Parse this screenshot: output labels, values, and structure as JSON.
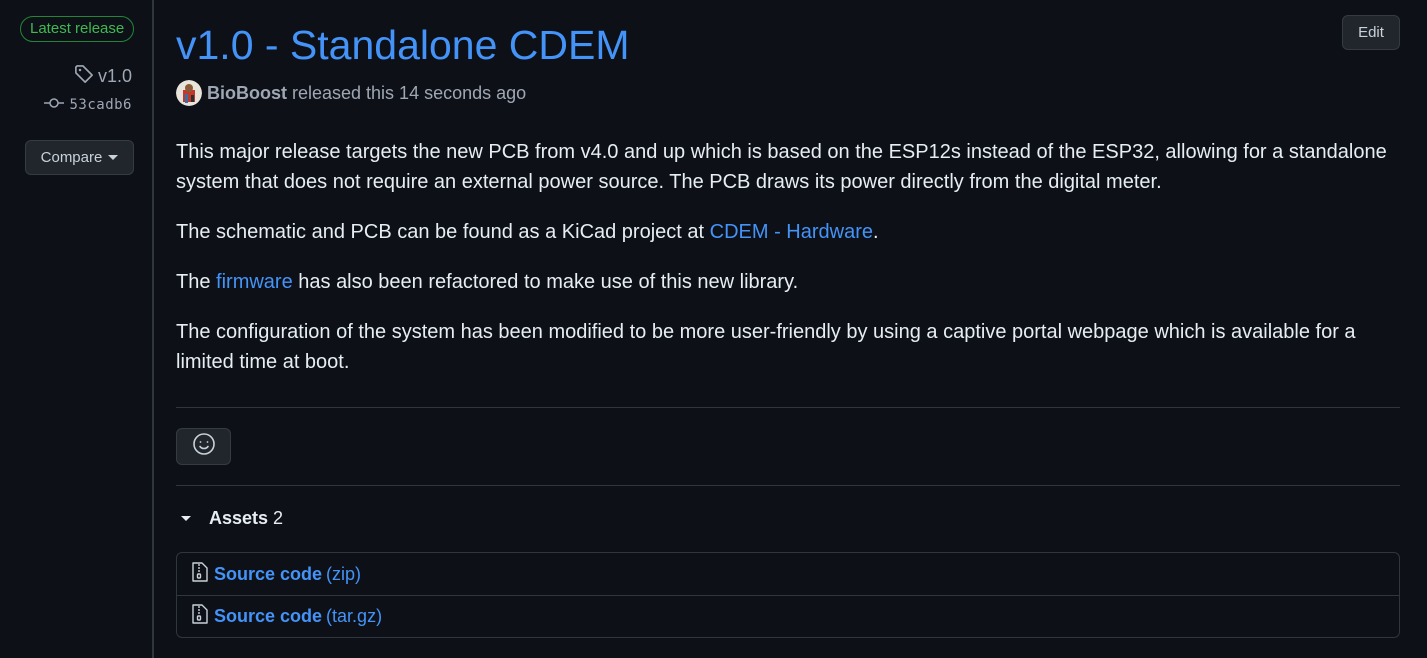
{
  "sidebar": {
    "badge": "Latest release",
    "tag": "v1.0",
    "commit": "53cadb6",
    "compare_label": "Compare"
  },
  "release": {
    "title": "v1.0 - Standalone CDEM",
    "edit_label": "Edit",
    "author": "BioBoost",
    "released_text": "released this 14 seconds ago"
  },
  "body": {
    "p1": "This major release targets the new PCB from v4.0 and up which is based on the ESP12s instead of the ESP32, allowing for a standalone system that does not require an external power source. The PCB draws its power directly from the digital meter.",
    "p2_before": "The schematic and PCB can be found as a KiCad project at ",
    "p2_link": "CDEM - Hardware",
    "p2_after": ".",
    "p3_before": "The ",
    "p3_link": "firmware",
    "p3_after": " has also been refactored to make use of this new library.",
    "p4": "The configuration of the system has been modified to be more user-friendly by using a captive portal webpage which is available for a limited time at boot."
  },
  "assets": {
    "label": "Assets",
    "count": "2",
    "items": [
      {
        "name": "Source code",
        "ext": "(zip)"
      },
      {
        "name": "Source code",
        "ext": "(tar.gz)"
      }
    ]
  },
  "colors": {
    "background": "#0d1117",
    "link": "#4493f8",
    "badge_green": "#3fb950",
    "border": "#30363d"
  }
}
